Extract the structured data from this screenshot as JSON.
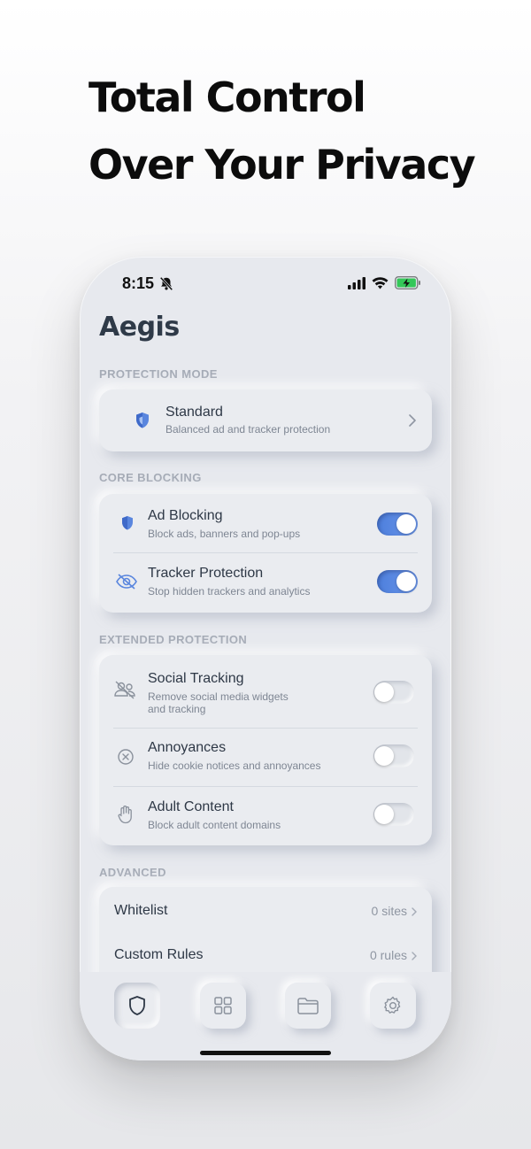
{
  "headline": {
    "line1": "Total Control",
    "line2": "Over Your Privacy"
  },
  "status_bar": {
    "time": "8:15"
  },
  "app": {
    "title": "Aegis"
  },
  "protection_mode": {
    "label": "PROTECTION MODE",
    "title": "Standard",
    "subtitle": "Balanced ad and tracker protection"
  },
  "core_blocking": {
    "label": "CORE BLOCKING",
    "items": [
      {
        "title": "Ad Blocking",
        "subtitle": "Block ads, banners and pop-ups",
        "enabled": true,
        "icon": "shield-icon"
      },
      {
        "title": "Tracker Protection",
        "subtitle": "Stop hidden trackers and analytics",
        "enabled": true,
        "icon": "eye-slash-icon"
      }
    ]
  },
  "extended_protection": {
    "label": "EXTENDED PROTECTION",
    "items": [
      {
        "title": "Social Tracking",
        "subtitle_line1": "Remove social media widgets",
        "subtitle_line2": "and tracking",
        "enabled": false,
        "icon": "people-slash-icon"
      },
      {
        "title": "Annoyances",
        "subtitle": "Hide cookie notices and annoyances",
        "enabled": false,
        "icon": "x-circle-icon"
      },
      {
        "title": "Adult Content",
        "subtitle": "Block adult content domains",
        "enabled": false,
        "icon": "hand-icon"
      }
    ]
  },
  "advanced": {
    "label": "ADVANCED",
    "items": [
      {
        "title": "Whitelist",
        "value": "0 sites"
      },
      {
        "title": "Custom Rules",
        "value": "0 rules"
      }
    ]
  },
  "tabs": [
    "shield-tab",
    "grid-tab",
    "folder-tab",
    "settings-tab"
  ],
  "colors": {
    "accent": "#4d7fdc",
    "background": "#e7e9ee",
    "text": "#2e3846"
  }
}
